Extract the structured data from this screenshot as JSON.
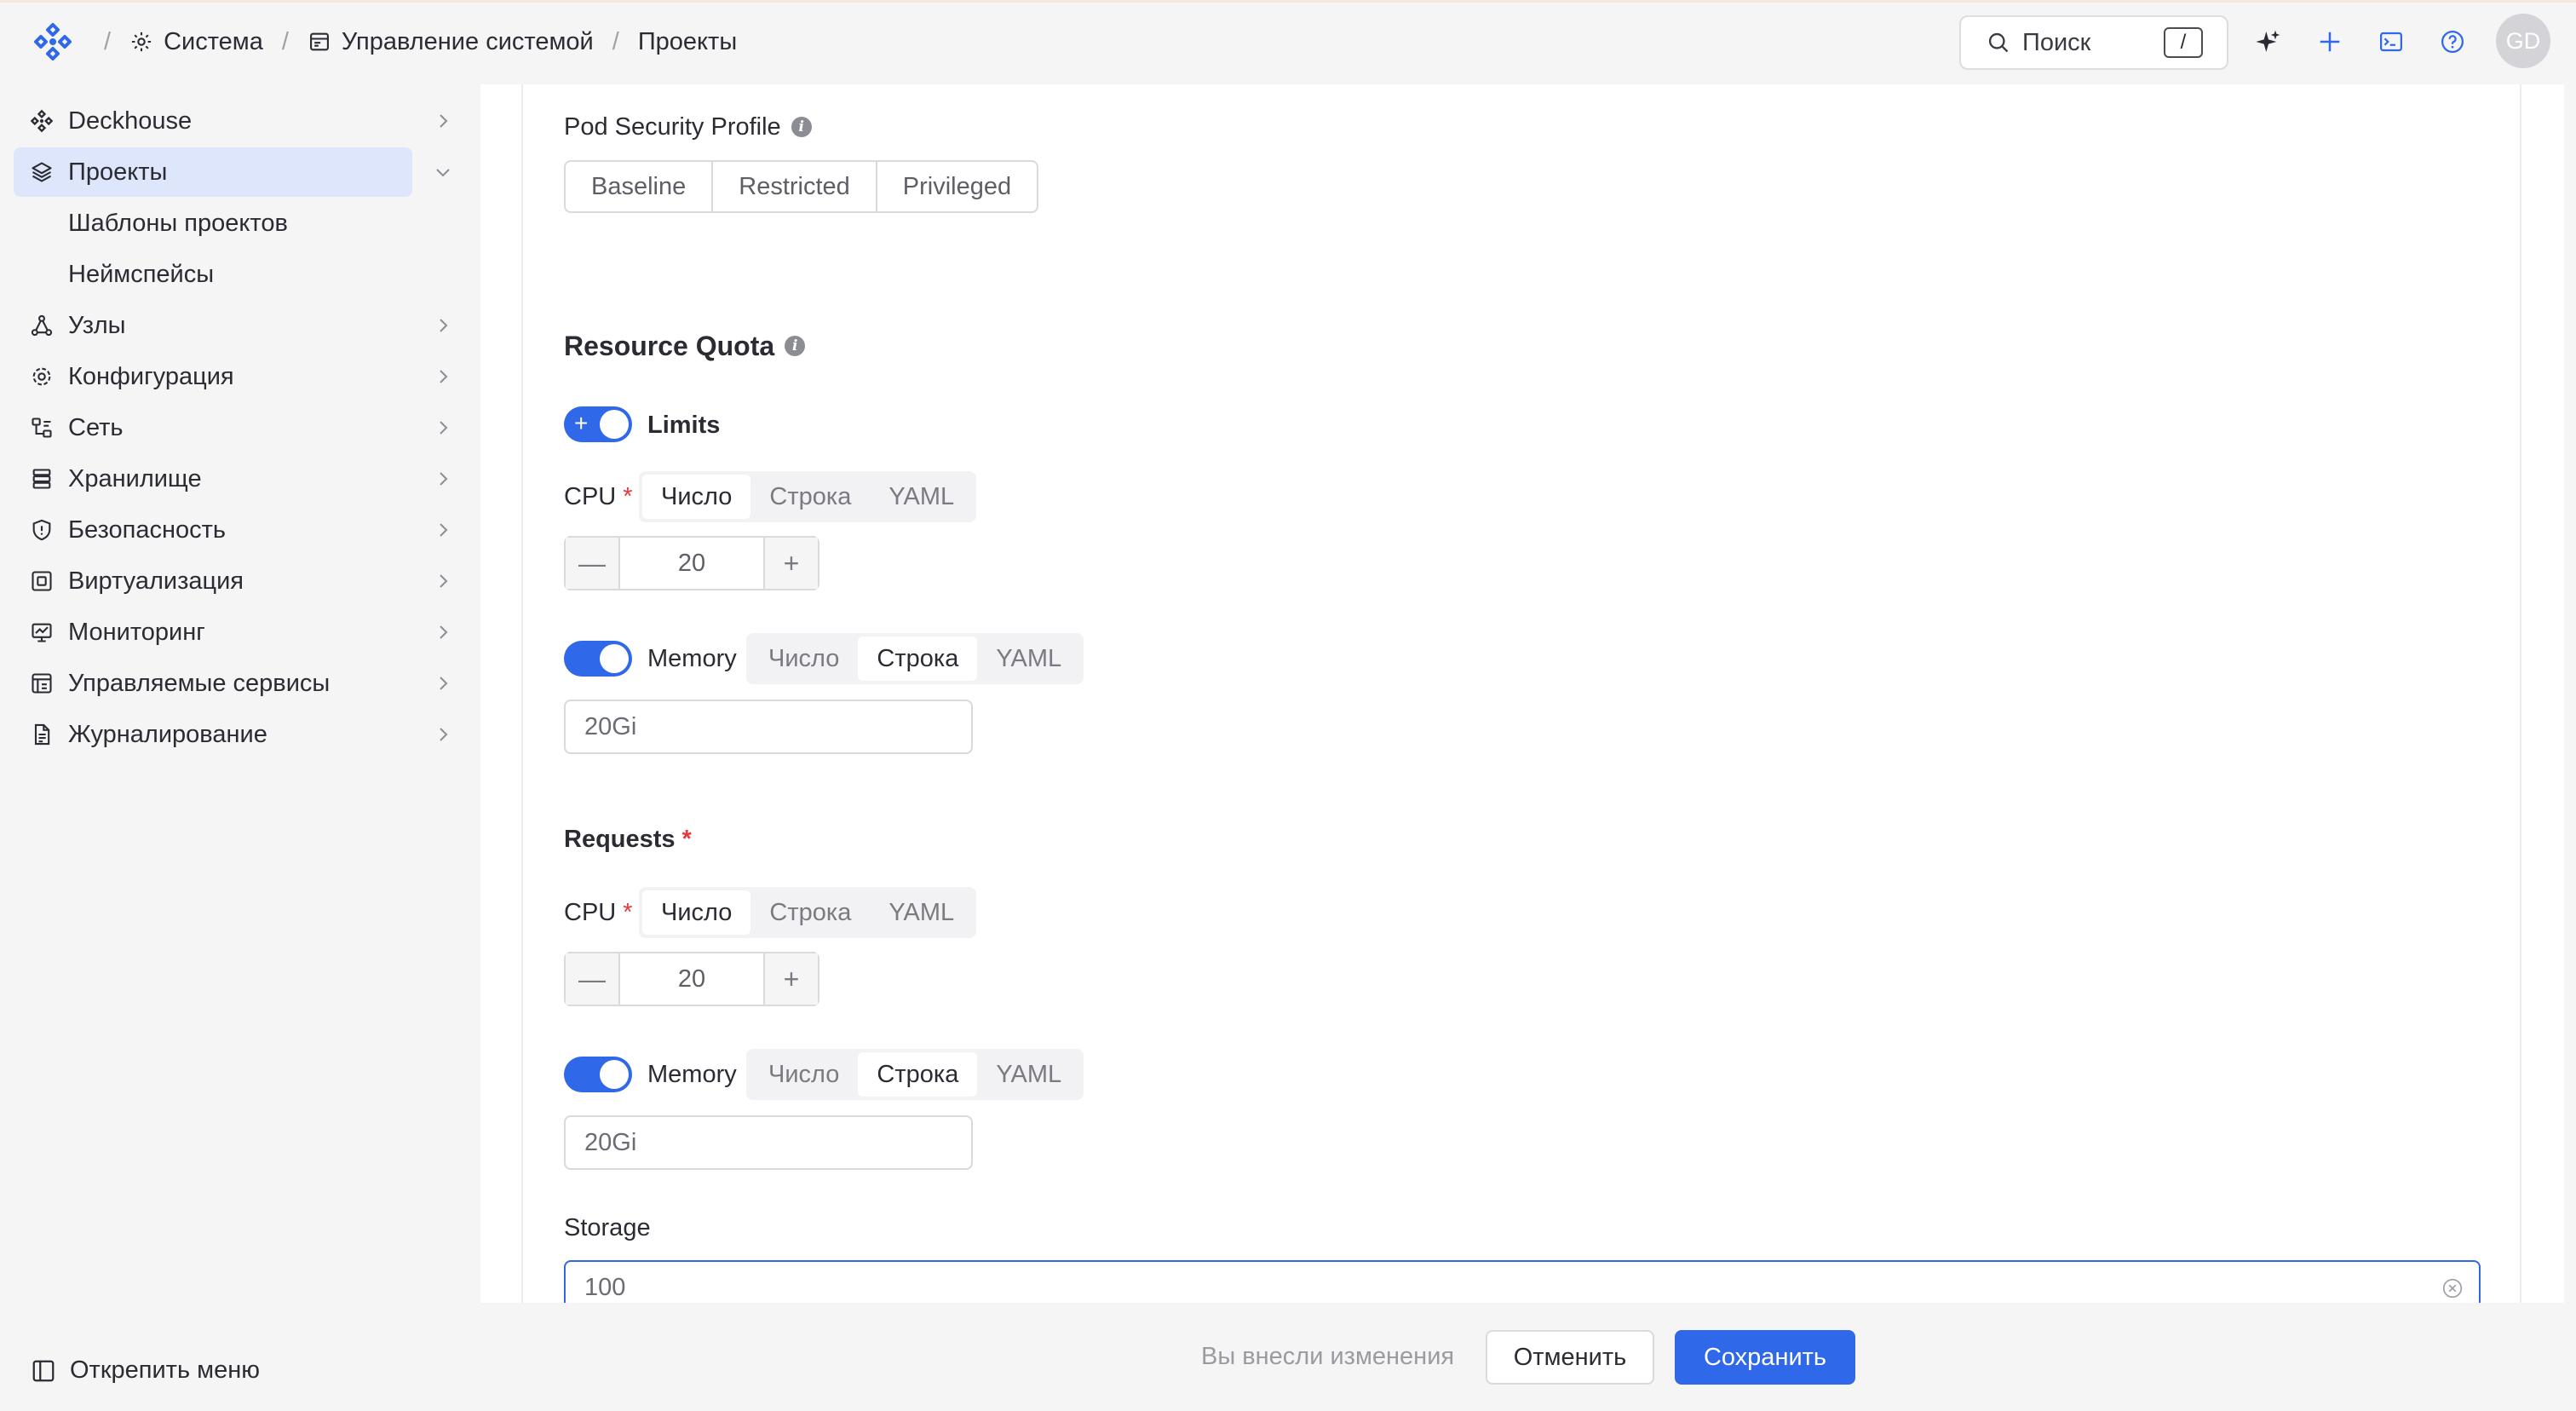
{
  "breadcrumbs": {
    "logo_icon": "deckhouse-logo-icon",
    "items": [
      {
        "label": "Система",
        "icon": "gear-icon"
      },
      {
        "label": "Управление системой",
        "icon": "panel-icon"
      },
      {
        "label": "Проекты"
      }
    ],
    "separator": "/"
  },
  "header": {
    "search_label": "Поиск",
    "search_shortcut": "/",
    "icons": [
      "sparkle-icon",
      "plus-icon",
      "terminal-icon",
      "help-icon"
    ],
    "avatar_initials": "GD"
  },
  "sidebar": {
    "items": [
      {
        "label": "Deckhouse",
        "icon": "deckhouse-icon"
      },
      {
        "label": "Проекты",
        "icon": "layers-icon",
        "active": true,
        "expanded": true
      },
      {
        "label": "Узлы",
        "icon": "nodes-icon"
      },
      {
        "label": "Конфигурация",
        "icon": "gear-icon"
      },
      {
        "label": "Сеть",
        "icon": "network-icon"
      },
      {
        "label": "Хранилище",
        "icon": "storage-icon"
      },
      {
        "label": "Безопасность",
        "icon": "shield-icon"
      },
      {
        "label": "Виртуализация",
        "icon": "virtualization-icon"
      },
      {
        "label": "Мониторинг",
        "icon": "monitor-icon"
      },
      {
        "label": "Управляемые сервисы",
        "icon": "services-icon"
      },
      {
        "label": "Журналирование",
        "icon": "document-icon"
      }
    ],
    "subitems": [
      {
        "label": "Шаблоны проектов"
      },
      {
        "label": "Неймспейсы"
      }
    ],
    "unpin_label": "Открепить меню"
  },
  "form": {
    "pod_security": {
      "label": "Pod Security Profile",
      "options": [
        "Baseline",
        "Restricted",
        "Privileged"
      ]
    },
    "resource_quota": {
      "title": "Resource Quota",
      "limits": {
        "label": "Limits",
        "enabled": true,
        "cpu": {
          "label": "CPU",
          "required_mark": "*",
          "tabs": [
            "Число",
            "Строка",
            "YAML"
          ],
          "selected_tab": "Число",
          "value": "20",
          "minus": "—",
          "plus": "+"
        },
        "memory": {
          "label": "Memory",
          "enabled": true,
          "tabs": [
            "Число",
            "Строка",
            "YAML"
          ],
          "selected_tab": "Строка",
          "value": "20Gi"
        }
      },
      "requests": {
        "label": "Requests",
        "required_mark": "*",
        "cpu": {
          "label": "CPU",
          "required_mark": "*",
          "tabs": [
            "Число",
            "Строка",
            "YAML"
          ],
          "selected_tab": "Число",
          "value": "20",
          "minus": "—",
          "plus": "+"
        },
        "memory": {
          "label": "Memory",
          "enabled": true,
          "tabs": [
            "Число",
            "Строка",
            "YAML"
          ],
          "selected_tab": "Строка",
          "value": "20Gi"
        }
      },
      "storage": {
        "label": "Storage",
        "value": "100"
      }
    }
  },
  "footer": {
    "changes_text": "Вы внесли изменения",
    "cancel_label": "Отменить",
    "save_label": "Сохранить"
  },
  "colors": {
    "accent": "#2f68e8",
    "active_nav_bg": "#dde6fb",
    "required": "#e5393b",
    "background": "#f5f5f6"
  }
}
